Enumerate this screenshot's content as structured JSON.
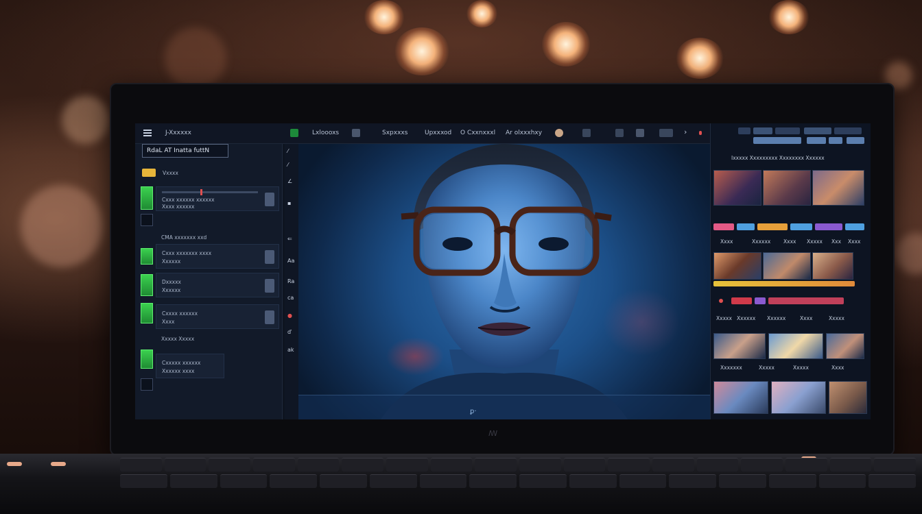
{
  "app": {
    "menu_title": "J-Xxxxxx",
    "project_name": "RdaL AT Inatta futtN",
    "logo_mark": "ꟿ"
  },
  "toolbar": {
    "items": [
      "Lxloooxs",
      "Sxpxxxs",
      "Upxxxod",
      "O Cxxnxxxl",
      "Ar olxxxhxy"
    ],
    "overflow": "›"
  },
  "left_panel": {
    "yellow_tag": "xx",
    "section_label": "Vxxxx",
    "layers": [
      {
        "title": "Cxxx xxxxxx xxxxxx",
        "sub": "Xxxx xxxxxx"
      },
      {
        "title": "Cxxx xxxxxxx xxxx",
        "sub": "Xxxxxx"
      },
      {
        "title": "Dxxxxx",
        "sub": "Xxxxxx"
      },
      {
        "title": "Cxxxx xxxxxx",
        "sub": "Xxxx"
      },
      {
        "title": "Cxxxxx xxxxxx",
        "sub": "Xxxxxx xxxx"
      }
    ],
    "group_label": "CMA xxxxxxx xxd",
    "footer_label": "Xxxxx Xxxxx"
  },
  "viewer": {
    "caption": "ꝑ·"
  },
  "right_panel": {
    "header": "Ixxxxx Xxxxxxxxx Xxxxxxxx Xxxxxx",
    "row_labels_1": [
      "Xxxx",
      "Xxxxxx",
      "Xxxx",
      "Xxxxx",
      "Xxx",
      "Xxxx"
    ],
    "row_labels_2": [
      "Xxxxx",
      "Xxxxxx",
      "Xxxxxx",
      "Xxxx",
      "Xxxxx"
    ],
    "row_labels_3": [
      "Xxxxxxx",
      "Xxxxx",
      "Xxxxx",
      "Xxxx"
    ]
  },
  "colors": {
    "accent_green": "#3bd14f",
    "accent_yellow": "#e7b53a",
    "accent_red": "#e05050",
    "panel_bg": "#121a29"
  },
  "icons": [
    "menu-icon",
    "slider-icon",
    "layer-thumb-icon",
    "brush-icon",
    "crop-icon",
    "eye-icon",
    "settings-icon"
  ]
}
